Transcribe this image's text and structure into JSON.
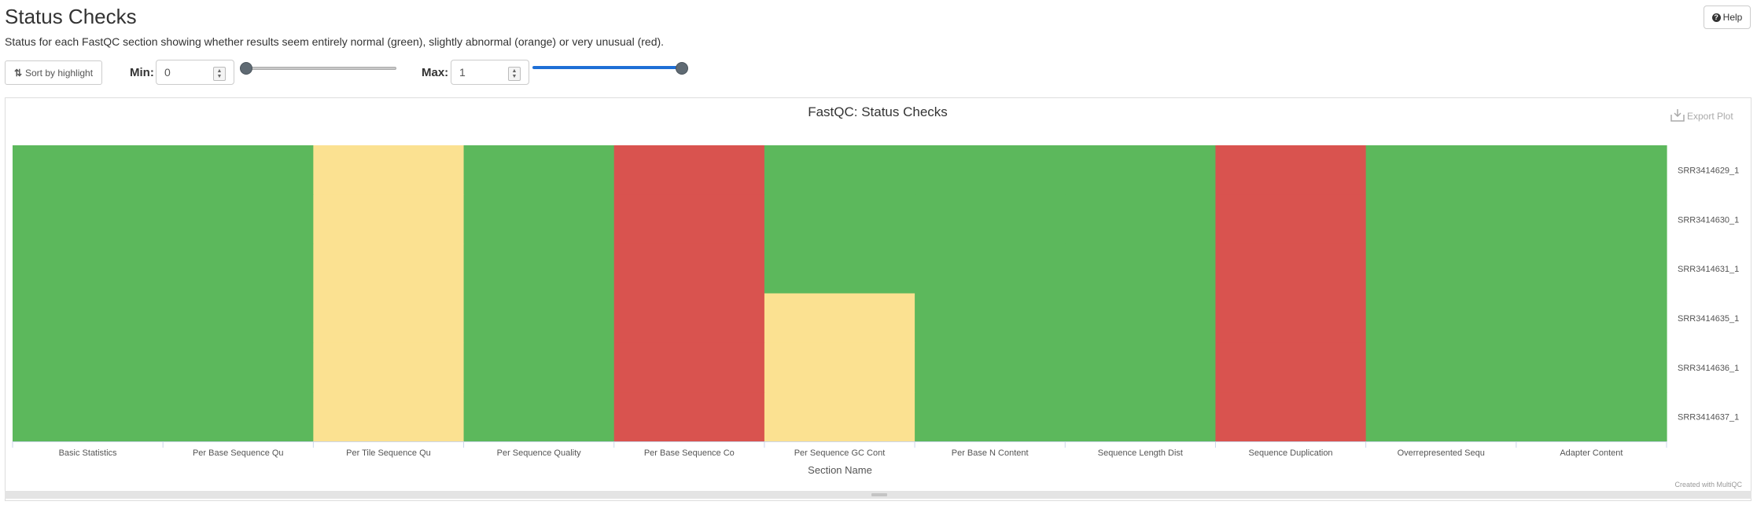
{
  "header": {
    "title": "Status Checks",
    "help_label": "Help",
    "subtitle": "Status for each FastQC section showing whether results seem entirely normal (green), slightly abnormal (orange) or very unusual (red)."
  },
  "controls": {
    "sort_label": "Sort by highlight",
    "min_label": "Min:",
    "min_value": "0",
    "max_label": "Max:",
    "max_value": "1",
    "slider_min_level": 0,
    "slider_max_level": 1
  },
  "plot": {
    "export_label": "Export Plot",
    "credit": "Created with MultiQC"
  },
  "colors": {
    "pass": "#5cb85c",
    "warn": "#fbe191",
    "fail": "#d9534f",
    "slider_active": "#1e6fd6",
    "slider_inactive": "#c8c8c8"
  },
  "chart_data": {
    "type": "heatmap",
    "title": "FastQC: Status Checks",
    "xlabel": "Section Name",
    "ylabel": "",
    "categories": [
      "Basic Statistics",
      "Per Base Sequence Qu",
      "Per Tile Sequence Qu",
      "Per Sequence Quality",
      "Per Base Sequence Co",
      "Per Sequence GC Cont",
      "Per Base N Content",
      "Sequence Length Dist",
      "Sequence Duplication",
      "Overrepresented Sequ",
      "Adapter Content"
    ],
    "samples": [
      "SRR3414629_1",
      "SRR3414630_1",
      "SRR3414631_1",
      "SRR3414635_1",
      "SRR3414636_1",
      "SRR3414637_1"
    ],
    "status_values": {
      "pass": 1,
      "warn": 0.5,
      "fail": 0.25
    },
    "values": [
      [
        1,
        1,
        0.5,
        1,
        0.25,
        1,
        1,
        1,
        0.25,
        1,
        1
      ],
      [
        1,
        1,
        0.5,
        1,
        0.25,
        1,
        1,
        1,
        0.25,
        1,
        1
      ],
      [
        1,
        1,
        0.5,
        1,
        0.25,
        1,
        1,
        1,
        0.25,
        1,
        1
      ],
      [
        1,
        1,
        0.5,
        1,
        0.25,
        0.5,
        1,
        1,
        0.25,
        1,
        1
      ],
      [
        1,
        1,
        0.5,
        1,
        0.25,
        0.5,
        1,
        1,
        0.25,
        1,
        1
      ],
      [
        1,
        1,
        0.5,
        1,
        0.25,
        0.5,
        1,
        1,
        0.25,
        1,
        1
      ]
    ]
  }
}
